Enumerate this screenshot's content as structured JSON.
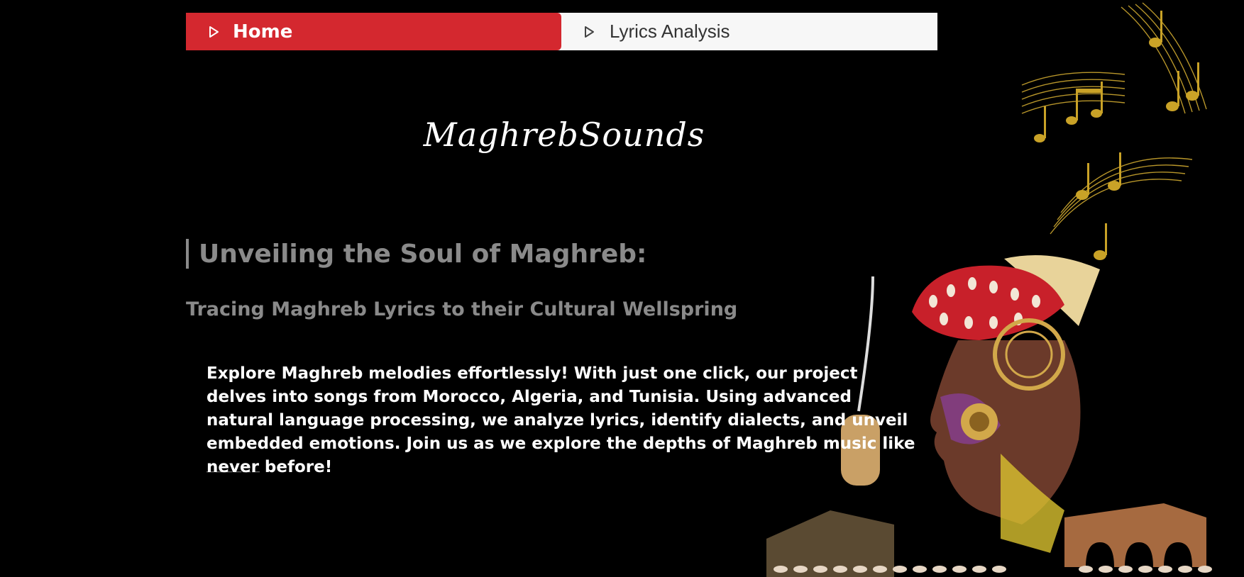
{
  "nav": {
    "home_label": "Home",
    "lyrics_label": "Lyrics Analysis",
    "home_color": "#d4282f"
  },
  "brand": "MaghrebSounds",
  "hero": {
    "headline": "Unveiling the Soul of Maghreb:",
    "subheadline": "Tracing Maghreb Lyrics to their Cultural Wellspring",
    "intro": "Explore Maghreb melodies effortlessly! With just one click, our project delves into songs from Morocco, Algeria, and Tunisia. Using advanced natural language processing, we analyze lyrics, identify dialects, and unveil embedded emotions. Join us as we explore the depths of Maghreb music like never before!",
    "divider": "______"
  },
  "art": {
    "icon": "maghreb-musician-illustration",
    "accent_gold": "#c9a227",
    "accent_red": "#c8202a"
  }
}
